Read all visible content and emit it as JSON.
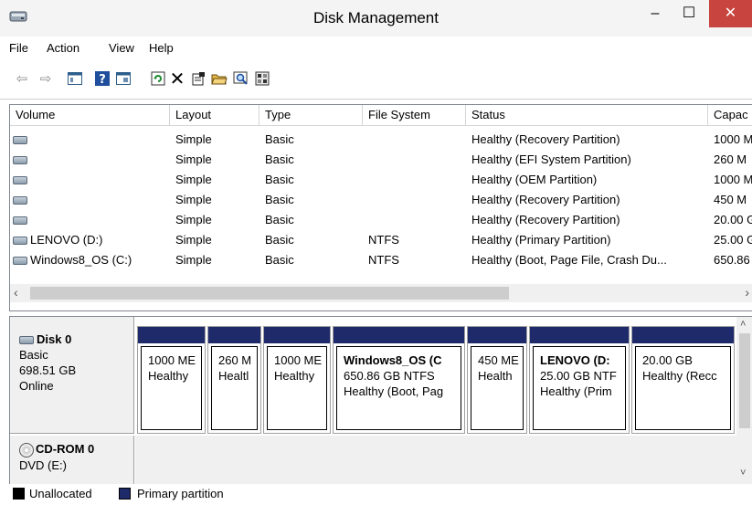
{
  "window": {
    "title": "Disk Management",
    "minimize": "–",
    "maximize": "☐",
    "close": "✕"
  },
  "menu": {
    "file": "File",
    "action": "Action",
    "view": "View",
    "help": "Help"
  },
  "toolbar": {
    "icons": [
      "back-icon",
      "forward-icon",
      "console-icon",
      "help-icon",
      "panel-icon",
      "refresh-icon",
      "delete-icon",
      "properties-icon",
      "open-icon",
      "search-icon",
      "settings-icon"
    ]
  },
  "volume_list": {
    "headers": {
      "volume": "Volume",
      "layout": "Layout",
      "type": "Type",
      "file_system": "File System",
      "status": "Status",
      "capacity": "Capac"
    },
    "rows": [
      {
        "volume": "",
        "layout": "Simple",
        "type": "Basic",
        "fs": "",
        "status": "Healthy (Recovery Partition)",
        "capacity": "1000 M"
      },
      {
        "volume": "",
        "layout": "Simple",
        "type": "Basic",
        "fs": "",
        "status": "Healthy (EFI System Partition)",
        "capacity": "260 M"
      },
      {
        "volume": "",
        "layout": "Simple",
        "type": "Basic",
        "fs": "",
        "status": "Healthy (OEM Partition)",
        "capacity": "1000 M"
      },
      {
        "volume": "",
        "layout": "Simple",
        "type": "Basic",
        "fs": "",
        "status": "Healthy (Recovery Partition)",
        "capacity": "450 M"
      },
      {
        "volume": "",
        "layout": "Simple",
        "type": "Basic",
        "fs": "",
        "status": "Healthy (Recovery Partition)",
        "capacity": "20.00 G"
      },
      {
        "volume": "LENOVO (D:)",
        "layout": "Simple",
        "type": "Basic",
        "fs": "NTFS",
        "status": "Healthy (Primary Partition)",
        "capacity": "25.00 G"
      },
      {
        "volume": "Windows8_OS (C:)",
        "layout": "Simple",
        "type": "Basic",
        "fs": "NTFS",
        "status": "Healthy (Boot, Page File, Crash Du...",
        "capacity": "650.86"
      }
    ]
  },
  "disk0": {
    "name": "Disk 0",
    "kind": "Basic",
    "size": "698.51 GB",
    "state": "Online",
    "partitions": [
      {
        "name": "",
        "size": "1000 ME",
        "status": "Healthy"
      },
      {
        "name": "",
        "size": "260 M",
        "status": "Healtl"
      },
      {
        "name": "",
        "size": "1000 ME",
        "status": "Healthy"
      },
      {
        "name": "Windows8_OS (C",
        "size": "650.86 GB NTFS",
        "status": "Healthy (Boot, Pag"
      },
      {
        "name": "",
        "size": "450 ME",
        "status": "Health"
      },
      {
        "name": "LENOVO (D:",
        "size": "25.00 GB NTF",
        "status": "Healthy (Prim"
      },
      {
        "name": "",
        "size": "20.00 GB",
        "status": "Healthy (Recc"
      }
    ]
  },
  "cdrom": {
    "name": "CD-ROM 0",
    "drive": "DVD (E:)"
  },
  "legend": {
    "unallocated": "Unallocated",
    "primary": "Primary partition",
    "unallocated_color": "#000000",
    "primary_color": "#1f2a6b"
  }
}
